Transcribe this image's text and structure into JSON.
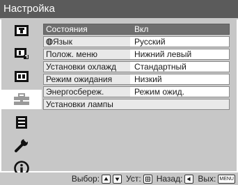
{
  "header": {
    "title": "Настройка"
  },
  "sidebar": {
    "icons": [
      "picture-settings-icon",
      "advanced-picture-icon",
      "screen-settings-icon",
      "setup-toolbox-icon",
      "menu-list-icon",
      "wrench-icon",
      "information-icon"
    ],
    "selected_index": 3
  },
  "menu": {
    "rows": [
      {
        "label": "Состояния",
        "value": "Вкл",
        "selected": true
      },
      {
        "label": "Язык",
        "value": "Русский",
        "icon": "language-icon"
      },
      {
        "label": "Полож. меню",
        "value": "Нижний левый"
      },
      {
        "label": "Установки охлажд",
        "value": "Стандартный"
      },
      {
        "label": "Режим ожидания",
        "value": "Низкий"
      },
      {
        "label": "Энергосбереж.",
        "value": "Режим ожид."
      },
      {
        "label": "Установки лампы",
        "value": ""
      }
    ]
  },
  "footer": {
    "select_label": "Выбор:",
    "set_label": "Уст:",
    "back_label": "Назад:",
    "exit_label": "Вых:",
    "menu_key": "MENU"
  },
  "colors": {
    "title_bar": "#5b5b5b",
    "panel": "#c7c7c7",
    "selected_row": "#6e6e6e",
    "label_cell": "#e9e9e9"
  }
}
